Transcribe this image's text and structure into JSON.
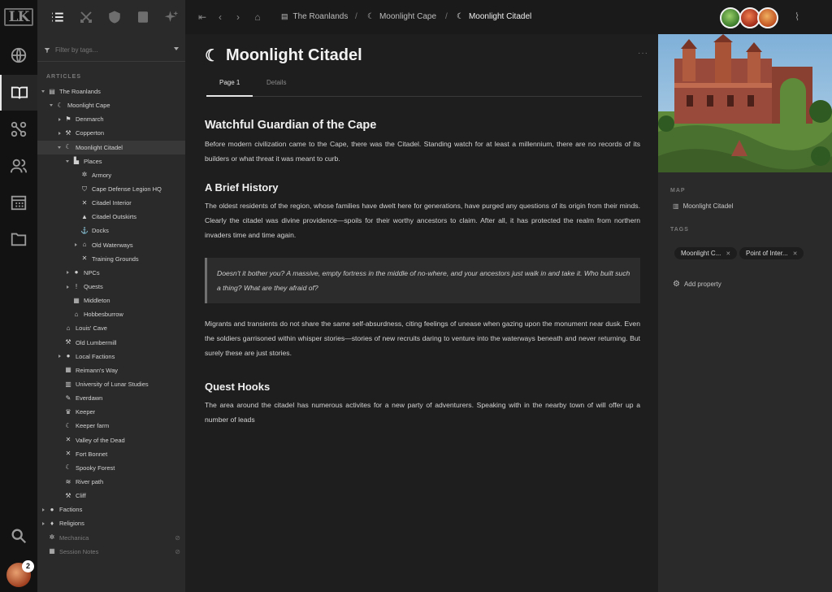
{
  "app": {
    "logo": "LK"
  },
  "user": {
    "notification_count": "2"
  },
  "sidebar": {
    "filter_placeholder": "Filter by tags...",
    "section_label": "ARTICLES",
    "tree": [
      {
        "label": "The Roanlands",
        "depth": 0,
        "arrow": "down",
        "icon": "book-icon",
        "glyph": "▤"
      },
      {
        "label": "Moonlight Cape",
        "depth": 1,
        "arrow": "down",
        "icon": "moon-icon",
        "glyph": "☾"
      },
      {
        "label": "Denmarch",
        "depth": 2,
        "arrow": "right",
        "icon": "flag-icon",
        "glyph": "⚑"
      },
      {
        "label": "Copperton",
        "depth": 2,
        "arrow": "right",
        "icon": "hammer-icon",
        "glyph": "⚒"
      },
      {
        "label": "Moonlight Citadel",
        "depth": 2,
        "arrow": "down",
        "icon": "moon-star-icon",
        "glyph": "☾",
        "selected": true
      },
      {
        "label": "Places",
        "depth": 3,
        "arrow": "down",
        "icon": "buildings-icon",
        "glyph": "▙"
      },
      {
        "label": "Armory",
        "depth": 4,
        "arrow": "",
        "icon": "gear-icon",
        "glyph": "✲"
      },
      {
        "label": "Cape Defense Legion HQ",
        "depth": 4,
        "arrow": "",
        "icon": "shield-icon",
        "glyph": "⛉"
      },
      {
        "label": "Citadel Interior",
        "depth": 4,
        "arrow": "",
        "icon": "swords-icon",
        "glyph": "✕"
      },
      {
        "label": "Citadel Outskirts",
        "depth": 4,
        "arrow": "",
        "icon": "camp-icon",
        "glyph": "▲"
      },
      {
        "label": "Docks",
        "depth": 4,
        "arrow": "",
        "icon": "anchor-icon",
        "glyph": "⚓"
      },
      {
        "label": "Old Waterways",
        "depth": 4,
        "arrow": "right",
        "icon": "columns-icon",
        "glyph": "⌂"
      },
      {
        "label": "Training Grounds",
        "depth": 4,
        "arrow": "",
        "icon": "swords-icon",
        "glyph": "✕"
      },
      {
        "label": "NPCs",
        "depth": 3,
        "arrow": "right",
        "icon": "person-icon",
        "glyph": "●"
      },
      {
        "label": "Quests",
        "depth": 3,
        "arrow": "right",
        "icon": "exclamation-icon",
        "glyph": "!"
      },
      {
        "label": "Middleton",
        "depth": 3,
        "arrow": "",
        "icon": "castle-icon",
        "glyph": "▦"
      },
      {
        "label": "Hobbesburrow",
        "depth": 3,
        "arrow": "",
        "icon": "house-icon",
        "glyph": "⌂"
      },
      {
        "label": "Louis' Cave",
        "depth": 2,
        "arrow": "",
        "icon": "columns-icon",
        "glyph": "⌂"
      },
      {
        "label": "Old Lumbermill",
        "depth": 2,
        "arrow": "",
        "icon": "hammer-icon",
        "glyph": "⚒"
      },
      {
        "label": "Local Factions",
        "depth": 2,
        "arrow": "right",
        "icon": "people-icon",
        "glyph": "●"
      },
      {
        "label": "Reimann's Way",
        "depth": 2,
        "arrow": "",
        "icon": "castle-icon",
        "glyph": "▦"
      },
      {
        "label": "University of Lunar Studies",
        "depth": 2,
        "arrow": "",
        "icon": "book-open-icon",
        "glyph": "▥"
      },
      {
        "label": "Everdawn",
        "depth": 2,
        "arrow": "",
        "icon": "feather-icon",
        "glyph": "✎"
      },
      {
        "label": "Keeper",
        "depth": 2,
        "arrow": "",
        "icon": "crown-icon",
        "glyph": "♛"
      },
      {
        "label": "Keeper farm",
        "depth": 2,
        "arrow": "",
        "icon": "moon-icon",
        "glyph": "☾"
      },
      {
        "label": "Valley of the Dead",
        "depth": 2,
        "arrow": "",
        "icon": "swords-icon",
        "glyph": "✕"
      },
      {
        "label": "Fort Bonnet",
        "depth": 2,
        "arrow": "",
        "icon": "swords-icon",
        "glyph": "✕"
      },
      {
        "label": "Spooky Forest",
        "depth": 2,
        "arrow": "",
        "icon": "moon-icon",
        "glyph": "☾"
      },
      {
        "label": "River path",
        "depth": 2,
        "arrow": "",
        "icon": "waves-icon",
        "glyph": "≋"
      },
      {
        "label": "Cliff",
        "depth": 2,
        "arrow": "",
        "icon": "pickaxe-icon",
        "glyph": "⚒"
      },
      {
        "label": "Factions",
        "depth": 0,
        "arrow": "right",
        "icon": "people-icon",
        "glyph": "●"
      },
      {
        "label": "Religions",
        "depth": 0,
        "arrow": "right",
        "icon": "pin-icon",
        "glyph": "♦"
      },
      {
        "label": "Mechanica",
        "depth": 0,
        "arrow": "",
        "icon": "gear-icon",
        "glyph": "✲",
        "dim": true,
        "hidden": true
      },
      {
        "label": "Session Notes",
        "depth": 0,
        "arrow": "",
        "icon": "table-icon",
        "glyph": "▦",
        "dim": true,
        "hidden": true
      }
    ]
  },
  "breadcrumbs": [
    {
      "label": "The Roanlands",
      "icon": "book-icon"
    },
    {
      "label": "Moonlight Cape",
      "icon": "moon-icon"
    },
    {
      "label": "Moonlight Citadel",
      "icon": "moon-star-icon"
    }
  ],
  "article": {
    "title": "Moonlight Citadel",
    "more_label": "···",
    "tabs": [
      "Page 1",
      "Details"
    ],
    "h1": "Watchful Guardian of the Cape",
    "p1": "Before modern civilization came to the Cape, there was the Citadel. Standing watch for at least a millennium, there are no records of its builders or what threat it was meant to curb.",
    "h2": "A Brief History",
    "p2": "The oldest residents of the region, whose families have dwelt here for generations, have purged any questions of its origin from their minds. Clearly the citadel was divine providence—spoils for their worthy ancestors to claim. After all, it has protected the realm from northern invaders time and time again.",
    "quote": "Doesn't it bother you? A massive, empty fortress in the middle of no-where, and your ancestors just walk in and take it. Who built such a thing? What are they afraid of?",
    "p3": "Migrants and transients do not share the same self-absurdness, citing feelings of unease when gazing upon the monument near dusk. Even the soldiers garrisoned within whisper stories—stories of new recruits daring to venture into the waterways beneath and never returning. But surely these are just stories.",
    "h3": "Quest Hooks",
    "p4": "The area around the citadel has numerous activites for a new party of adventurers. Speaking with  in the nearby town of will offer up a number of leads"
  },
  "right_panel": {
    "map_label": "MAP",
    "map_value": "Moonlight Citadel",
    "tags_label": "TAGS",
    "tags": [
      "Moonlight C...",
      "Point of Inter..."
    ],
    "add_property": "Add property"
  },
  "colors": {
    "accent": "#e8e8e8",
    "background": "#1e1e1e",
    "sidebar": "#2a2a2a"
  }
}
